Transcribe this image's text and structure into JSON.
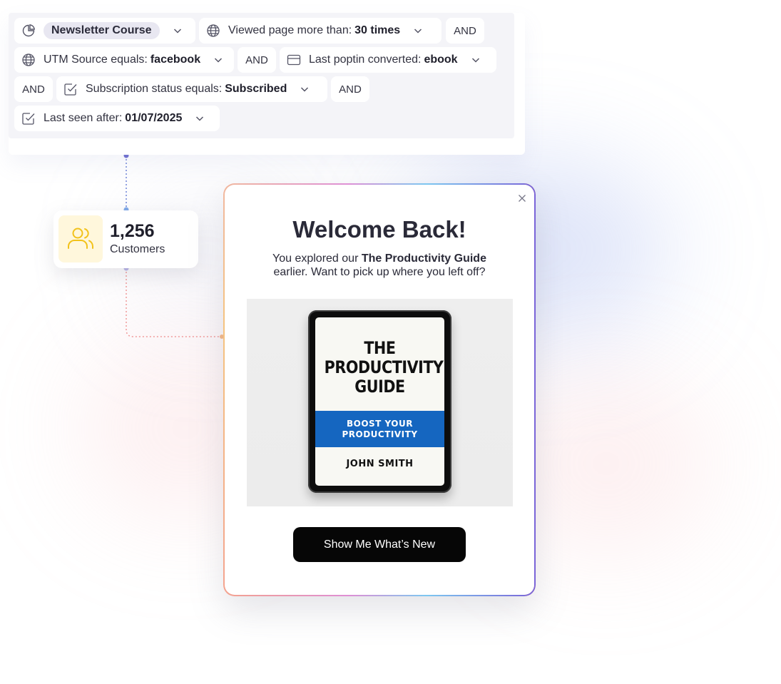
{
  "filters": {
    "row1": {
      "segment_label": "Newsletter Course",
      "viewed_prefix": "Viewed page more than:",
      "viewed_value": "30 times",
      "and1": "AND"
    },
    "row2": {
      "utm_prefix": "UTM Source equals:",
      "utm_value": "facebook",
      "and2": "AND",
      "poptin_prefix": "Last poptin converted:",
      "poptin_value": "ebook"
    },
    "row3": {
      "and3": "AND",
      "sub_prefix": "Subscription status equals:",
      "sub_value": "Subscribed",
      "and4": "AND"
    },
    "row4": {
      "seen_prefix": "Last seen after:",
      "seen_value": "01/07/2025"
    }
  },
  "customers": {
    "count": "1,256",
    "label": "Customers",
    "icon_color": "#f2c21a"
  },
  "popup": {
    "title": "Welcome Back!",
    "subtitle_before": "You explored our ",
    "subtitle_bold": "The Productivity Guide",
    "subtitle_after": "earlier. Want to pick up where you left off?",
    "book": {
      "title_line1": "THE",
      "title_line2": "PRODUCTIVITY",
      "title_line3": "GUIDE",
      "band_line1": "BOOST YOUR",
      "band_line2": "PRODUCTIVITY",
      "author": "JOHN SMITH",
      "band_color": "#1566c0"
    },
    "cta_label": "Show Me What’s New"
  }
}
